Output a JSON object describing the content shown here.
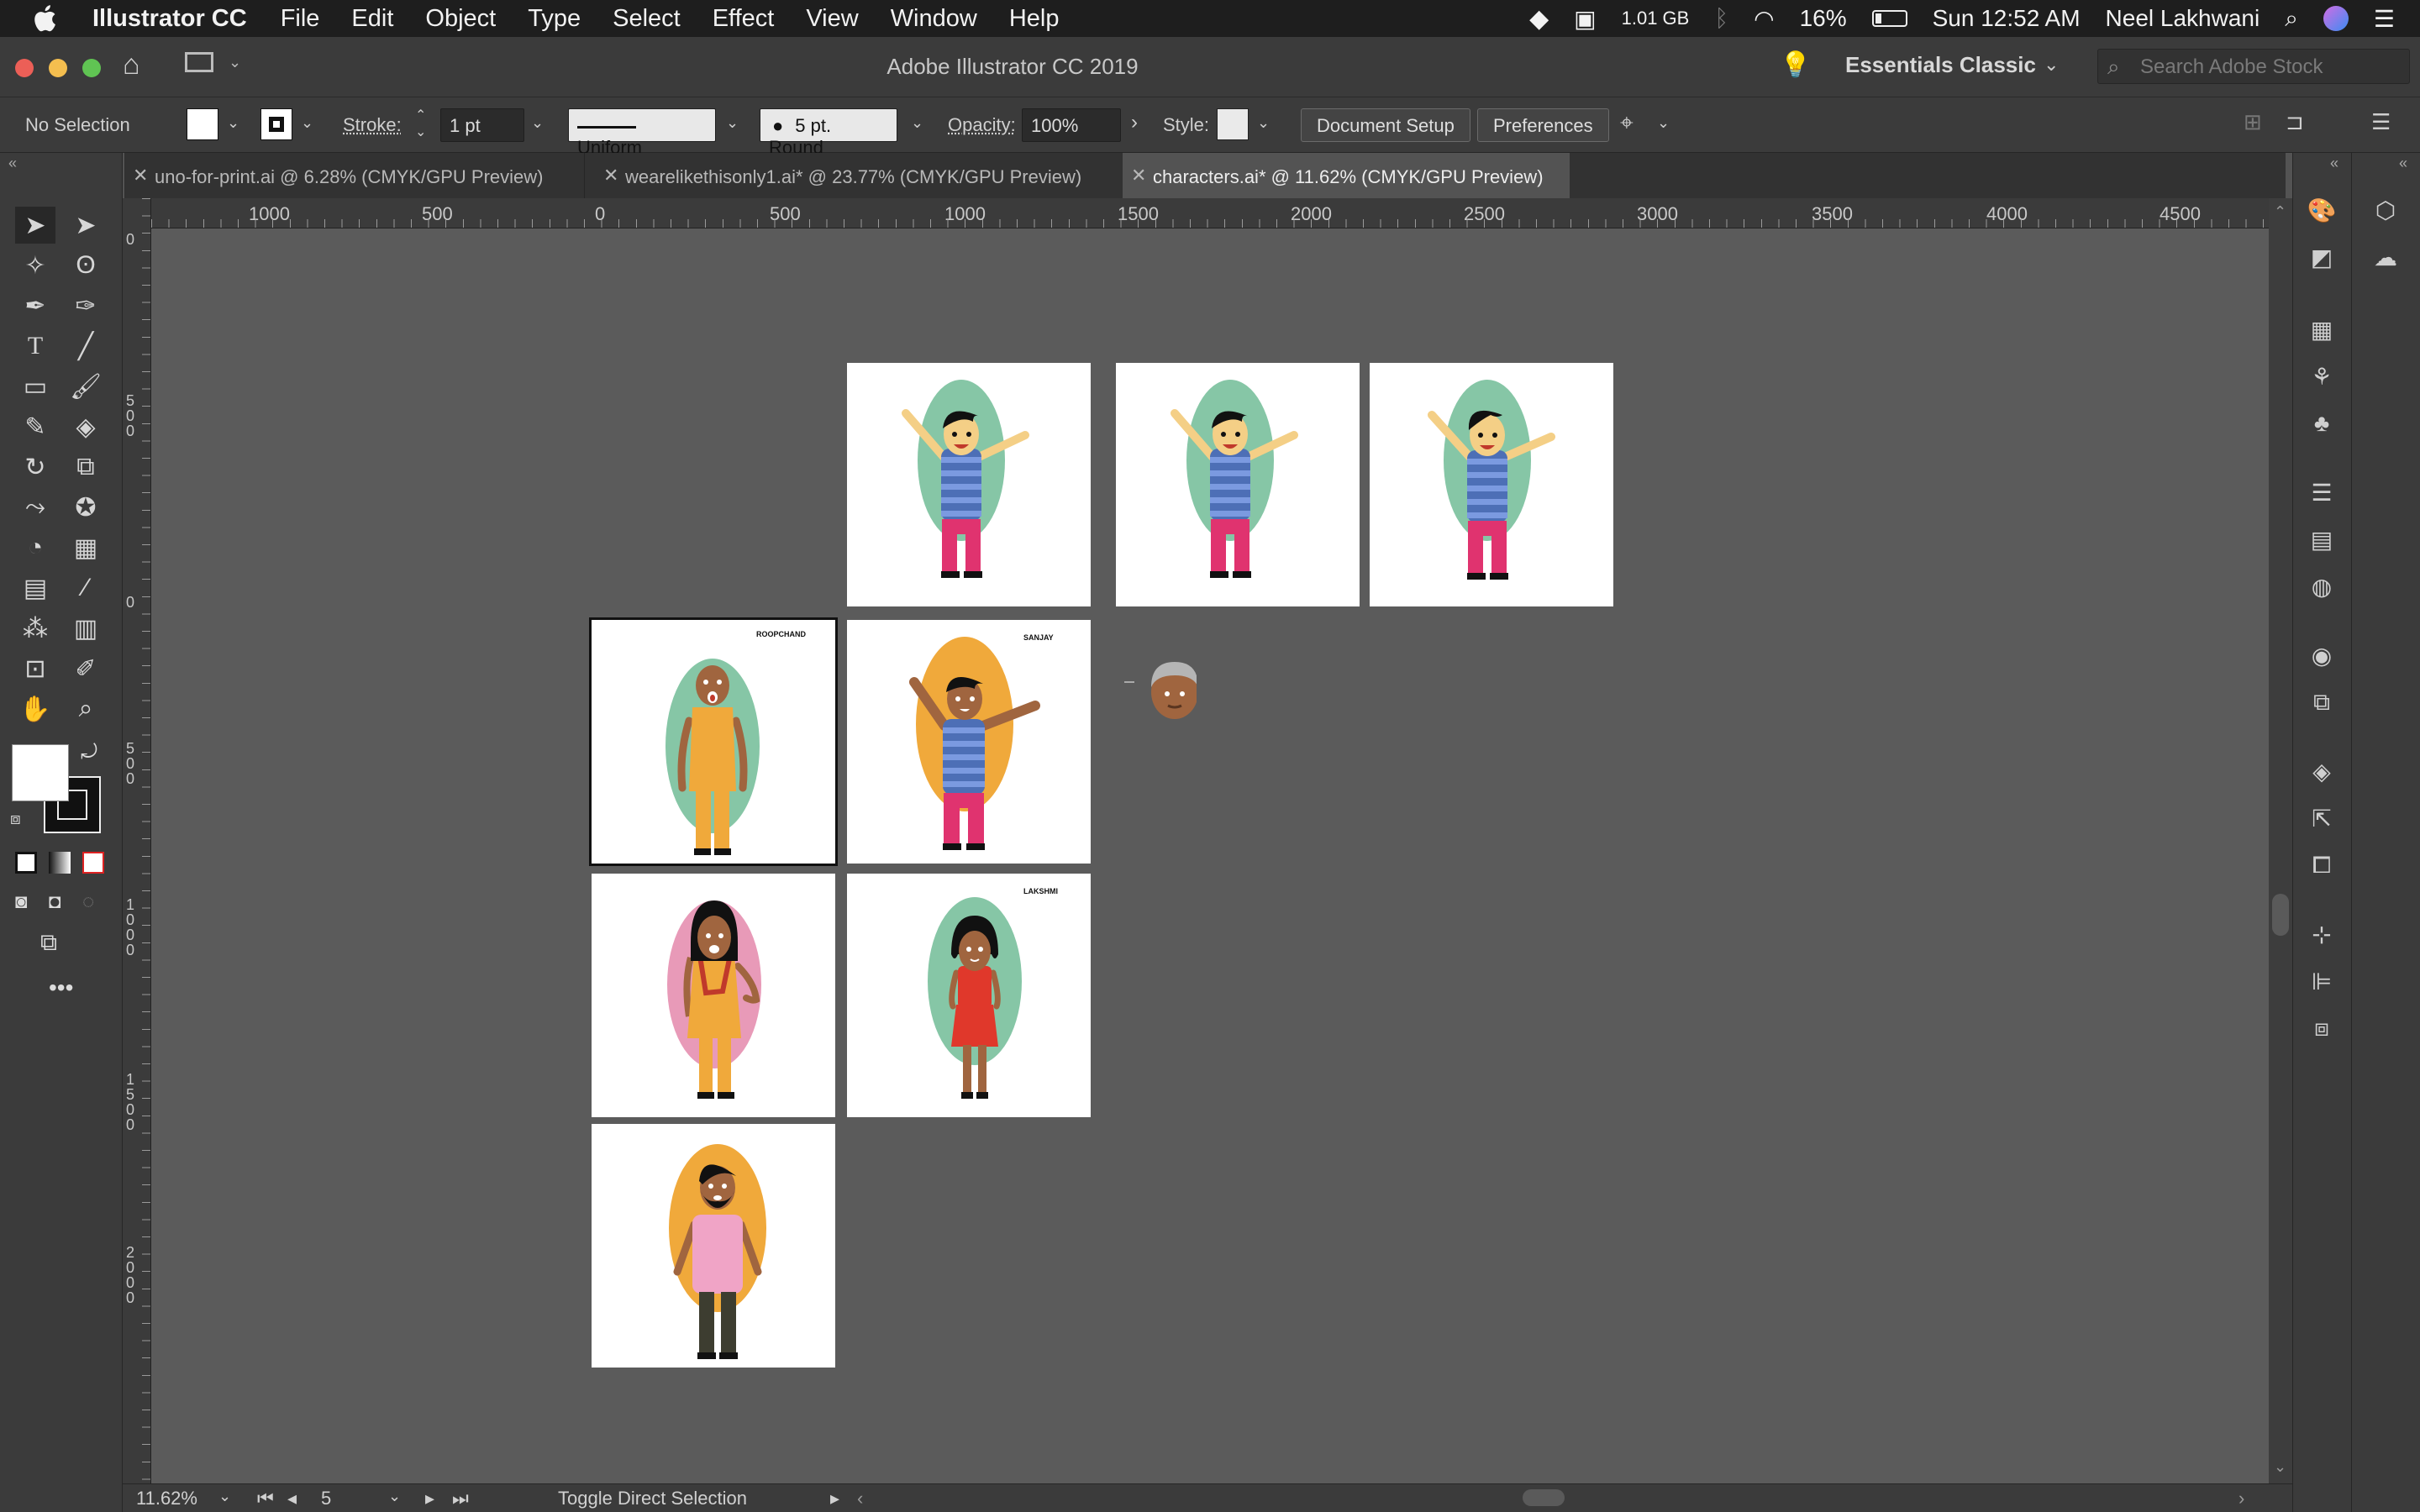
{
  "menubar": {
    "app_name": "Illustrator CC",
    "items": [
      "File",
      "Edit",
      "Object",
      "Type",
      "Select",
      "Effect",
      "View",
      "Window",
      "Help"
    ],
    "memory": "1.01 GB",
    "battery": "16%",
    "clock": "Sun 12:52 AM",
    "user": "Neel Lakhwani"
  },
  "titlebar": {
    "title": "Adobe Illustrator CC 2019",
    "workspace": "Essentials Classic",
    "search_placeholder": "Search Adobe Stock"
  },
  "controlbar": {
    "selection": "No Selection",
    "stroke_label": "Stroke:",
    "stroke_value": "1 pt",
    "profile": "Uniform",
    "brush": "5 pt. Round",
    "opacity_label": "Opacity:",
    "opacity_value": "100%",
    "style_label": "Style:",
    "document_setup": "Document Setup",
    "preferences": "Preferences"
  },
  "tabs": [
    {
      "label": "uno-for-print.ai @ 6.28% (CMYK/GPU Preview)",
      "active": false
    },
    {
      "label": "wearelikethisonly1.ai* @ 23.77% (CMYK/GPU Preview)",
      "active": false
    },
    {
      "label": "characters.ai* @ 11.62% (CMYK/GPU Preview)",
      "active": true
    }
  ],
  "ruler": {
    "h_labels": [
      "1000",
      "500",
      "0",
      "500",
      "1000",
      "1500",
      "2000",
      "2500",
      "3000",
      "3500",
      "4000",
      "4500"
    ],
    "v_labels": [
      "0",
      "500",
      "0",
      "500",
      "1000",
      "1500",
      "2000"
    ]
  },
  "artboards": [
    {
      "label": ""
    },
    {
      "label": ""
    },
    {
      "label": ""
    },
    {
      "label": "ROOPCHAND"
    },
    {
      "label": "SANJAY"
    },
    {
      "label": ""
    },
    {
      "label": "LAKSHMI"
    },
    {
      "label": ""
    }
  ],
  "status": {
    "zoom": "11.62%",
    "artboard_number": "5",
    "tool_hint": "Toggle Direct Selection"
  },
  "colors": {
    "teal_blob": "#86c6a6",
    "orange_blob": "#f0a93b",
    "pink_blob": "#e89ab8",
    "stripe_blue": "#4d6fb6",
    "pants_pink": "#e0336f"
  }
}
